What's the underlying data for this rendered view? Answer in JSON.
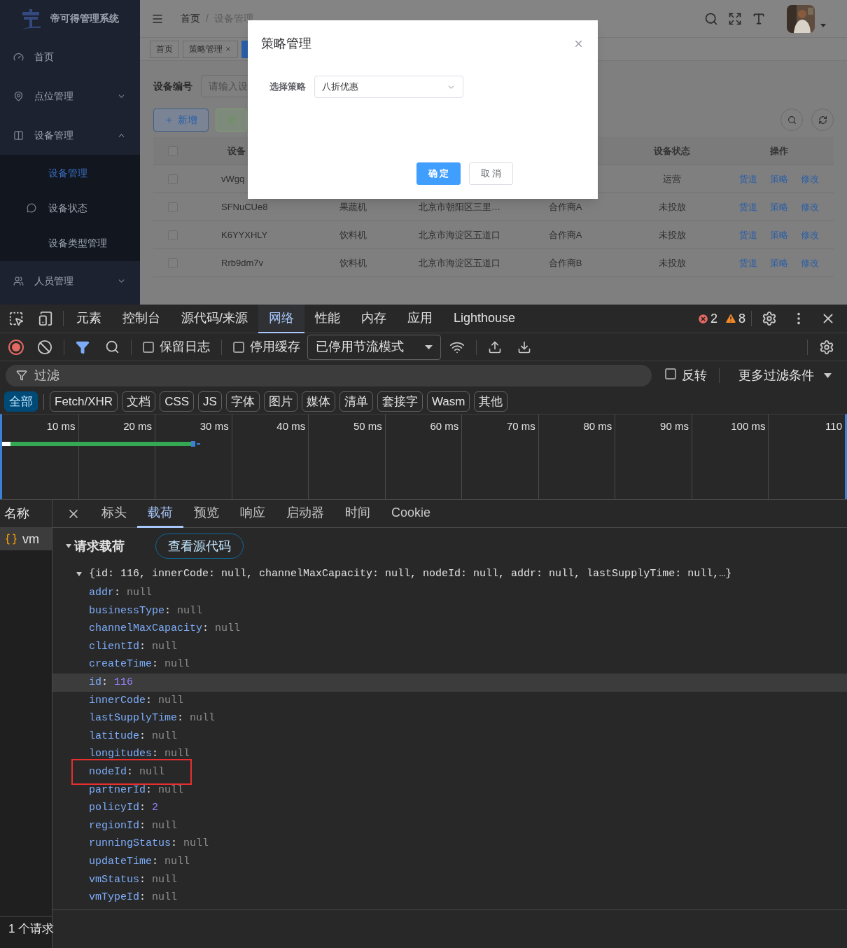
{
  "app": {
    "sidebar": {
      "title": "帝可得管理系统",
      "items": [
        {
          "label": "首页"
        },
        {
          "label": "点位管理",
          "expanded": false
        },
        {
          "label": "设备管理",
          "expanded": true,
          "children": [
            {
              "label": "设备管理",
              "selected": true
            },
            {
              "label": "设备状态",
              "selected": false
            },
            {
              "label": "设备类型管理",
              "selected": false
            }
          ]
        },
        {
          "label": "人员管理",
          "expanded": false
        }
      ]
    },
    "breadcrumb": {
      "separator": "/",
      "items": [
        "首页",
        "设备管理"
      ]
    },
    "tabs": [
      {
        "label": "首页",
        "selected": false,
        "closable": false
      },
      {
        "label": "策略管理",
        "selected": false,
        "closable": true
      },
      {
        "selected": true
      }
    ],
    "search": {
      "label": "设备编号",
      "placeholder": "请输入设"
    },
    "buttons": [
      {
        "label": "新增",
        "kind": "add"
      },
      {
        "kind": "edit"
      }
    ],
    "table": {
      "all_checked": false,
      "columns": {
        "code": "设备",
        "status": "设备状态",
        "actions": "操作"
      },
      "rows": [
        {
          "checked": false,
          "code": "vWgq",
          "status": "运营",
          "actions": [
            "货道",
            "策略",
            "修改"
          ]
        },
        {
          "checked": false,
          "code": "SFNuCUe8",
          "type": "果蔬机",
          "addr": "北京市朝阳区三里…",
          "partner": "合作商A",
          "status": "未投放",
          "actions": [
            "货道",
            "策略",
            "修改"
          ]
        },
        {
          "checked": false,
          "code": "K6YYXHLY",
          "type": "饮料机",
          "addr": "北京市海淀区五道口",
          "partner": "合作商A",
          "status": "未投放",
          "actions": [
            "货道",
            "策略",
            "修改"
          ]
        },
        {
          "checked": false,
          "code": "Rrb9dm7v",
          "type": "饮料机",
          "addr": "北京市海淀区五道口",
          "partner": "合作商B",
          "status": "未投放",
          "actions": [
            "货道",
            "策略",
            "修改"
          ]
        }
      ]
    }
  },
  "dialog": {
    "title": "策略管理",
    "field": {
      "label": "选择策略",
      "value": "八折优惠"
    },
    "buttons": [
      {
        "label": "确 定",
        "kind": "primary"
      },
      {
        "label": "取 消",
        "kind": "default"
      }
    ]
  },
  "devtools": {
    "tabs": [
      {
        "label": "元素",
        "selected": false
      },
      {
        "label": "控制台",
        "selected": false
      },
      {
        "label": "源代码/来源",
        "selected": false
      },
      {
        "label": "网络",
        "selected": true
      },
      {
        "label": "性能",
        "selected": false
      },
      {
        "label": "内存",
        "selected": false
      },
      {
        "label": "应用",
        "selected": false
      },
      {
        "label": "Lighthouse",
        "selected": false
      }
    ],
    "errors": "2",
    "warnings": "8",
    "recording": true,
    "filter_bar_shown": true,
    "preserve_log": {
      "label": "保留日志",
      "checked": false
    },
    "disable_cache": {
      "label": "停用缓存",
      "checked": false
    },
    "throttling": "已停用节流模式",
    "filter": {
      "placeholder": "过滤"
    },
    "invert": {
      "label": "反转",
      "checked": false
    },
    "more_filters": "更多过滤条件",
    "types": [
      {
        "label": "全部",
        "selected": true
      },
      {
        "label": "Fetch/XHR",
        "selected": false
      },
      {
        "label": "文档",
        "selected": false
      },
      {
        "label": "CSS",
        "selected": false
      },
      {
        "label": "JS",
        "selected": false
      },
      {
        "label": "字体",
        "selected": false
      },
      {
        "label": "图片",
        "selected": false
      },
      {
        "label": "媒体",
        "selected": false
      },
      {
        "label": "清单",
        "selected": false
      },
      {
        "label": "套接字",
        "selected": false
      },
      {
        "label": "Wasm",
        "selected": false
      },
      {
        "label": "其他",
        "selected": false
      }
    ],
    "timeline_ticks": [
      "10 ms",
      "20 ms",
      "30 ms",
      "40 ms",
      "50 ms",
      "60 ms",
      "70 ms",
      "80 ms",
      "90 ms",
      "100 ms",
      "110"
    ],
    "names_header": "名称",
    "requests": [
      {
        "name": "vm",
        "selected": true
      }
    ],
    "detail_tabs": [
      {
        "label": "标头",
        "selected": false
      },
      {
        "label": "载荷",
        "selected": true
      },
      {
        "label": "预览",
        "selected": false
      },
      {
        "label": "响应",
        "selected": false
      },
      {
        "label": "启动器",
        "selected": false
      },
      {
        "label": "时间",
        "selected": false
      },
      {
        "label": "Cookie",
        "selected": false
      }
    ],
    "payload": {
      "title": "请求载荷",
      "expanded": true,
      "view_source": "查看源代码",
      "object_expanded": true,
      "separator": ":",
      "summary": "{id: 116, innerCode: null, channelMaxCapacity: null, nodeId: null, addr: null, lastSupplyTime: null,…}",
      "properties": [
        {
          "key": "addr",
          "value": "null",
          "kind": "null",
          "highlighted": false,
          "annotated": false
        },
        {
          "key": "businessType",
          "value": "null",
          "kind": "null",
          "highlighted": false,
          "annotated": false
        },
        {
          "key": "channelMaxCapacity",
          "value": "null",
          "kind": "null",
          "highlighted": false,
          "annotated": false
        },
        {
          "key": "clientId",
          "value": "null",
          "kind": "null",
          "highlighted": false,
          "annotated": false
        },
        {
          "key": "createTime",
          "value": "null",
          "kind": "null",
          "highlighted": false,
          "annotated": false
        },
        {
          "key": "id",
          "value": "116",
          "kind": "number",
          "highlighted": true,
          "annotated": false
        },
        {
          "key": "innerCode",
          "value": "null",
          "kind": "null",
          "highlighted": false,
          "annotated": false
        },
        {
          "key": "lastSupplyTime",
          "value": "null",
          "kind": "null",
          "highlighted": false,
          "annotated": false
        },
        {
          "key": "latitude",
          "value": "null",
          "kind": "null",
          "highlighted": false,
          "annotated": false
        },
        {
          "key": "longitudes",
          "value": "null",
          "kind": "null",
          "highlighted": false,
          "annotated": false
        },
        {
          "key": "nodeId",
          "value": "null",
          "kind": "null",
          "highlighted": false,
          "annotated": true
        },
        {
          "key": "partnerId",
          "value": "null",
          "kind": "null",
          "highlighted": false,
          "annotated": false
        },
        {
          "key": "policyId",
          "value": "2",
          "kind": "number",
          "highlighted": false,
          "annotated": false
        },
        {
          "key": "regionId",
          "value": "null",
          "kind": "null",
          "highlighted": false,
          "annotated": false
        },
        {
          "key": "runningStatus",
          "value": "null",
          "kind": "null",
          "highlighted": false,
          "annotated": false
        },
        {
          "key": "updateTime",
          "value": "null",
          "kind": "null",
          "highlighted": false,
          "annotated": false
        },
        {
          "key": "vmStatus",
          "value": "null",
          "kind": "null",
          "highlighted": false,
          "annotated": false
        },
        {
          "key": "vmTypeId",
          "value": "null",
          "kind": "null",
          "highlighted": false,
          "annotated": false
        }
      ]
    },
    "status": "1 个请求"
  }
}
